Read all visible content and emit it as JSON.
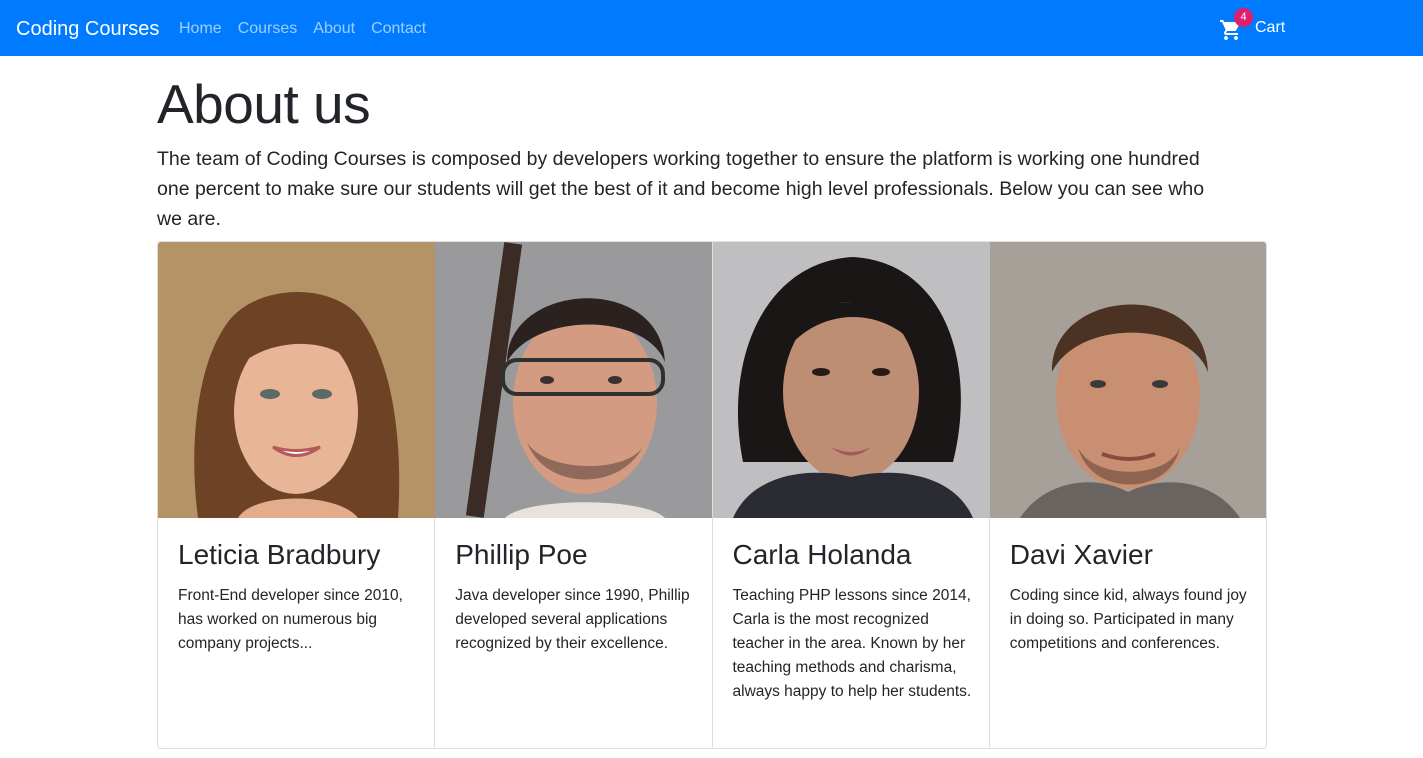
{
  "navbar": {
    "brand": "Coding Courses",
    "links": [
      "Home",
      "Courses",
      "About",
      "Contact"
    ],
    "cart": {
      "label": "Cart",
      "count": "4",
      "icon": "cart-icon"
    },
    "color": "#007bff"
  },
  "page": {
    "title": "About us",
    "intro_prefix": "The team of ",
    "intro_brand": "Coding Courses",
    "intro_suffix": " is composed by developers working together to ensure the platform is working one hundred one percent to make sure our students will get the best of it and become high level professionals. Below you can see who we are."
  },
  "team": [
    {
      "name": "Leticia Bradbury",
      "bio": "Front-End developer since 2010, has worked on numerous big company projects..."
    },
    {
      "name": "Phillip Poe",
      "bio": "Java developer since 1990, Phillip developed several applications recognized by their excellence."
    },
    {
      "name": "Carla Holanda",
      "bio": "Teaching PHP lessons since 2014, Carla is the most recognized teacher in the area. Known by her teaching methods and charisma, always happy to help her students."
    },
    {
      "name": "Davi Xavier",
      "bio": "Coding since kid, always found joy in doing so. Participated in many competitions and conferences."
    }
  ]
}
